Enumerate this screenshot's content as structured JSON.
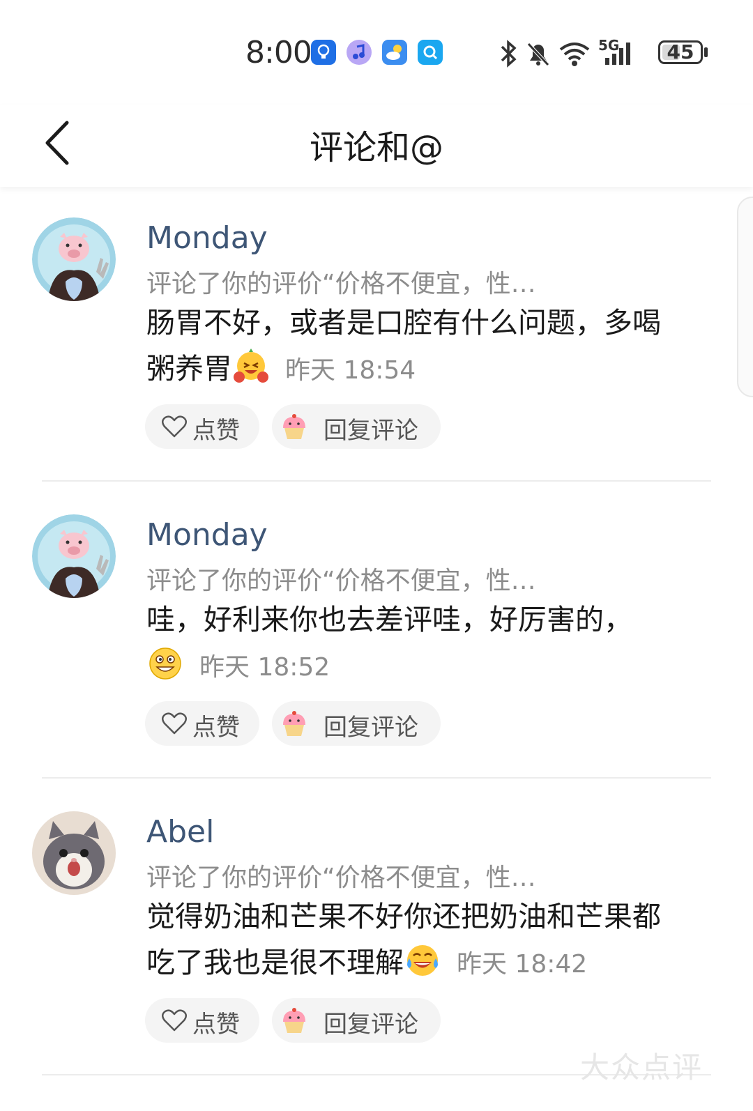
{
  "status_bar": {
    "time": "8:00",
    "app_icons": [
      "lightbulb-icon",
      "music-icon",
      "weather-icon",
      "search-app-icon"
    ],
    "indicators": [
      "bluetooth-icon",
      "mute-bell-icon",
      "wifi-icon",
      "signal-5g-icon"
    ],
    "network_label": "5G",
    "battery_level": "45"
  },
  "header": {
    "title": "评论和@",
    "back_icon": "chevron-left-icon"
  },
  "comments": [
    {
      "user": "Monday",
      "context": "评论了你的评价“价格不便宜，性…",
      "text_line1": "肠胃不好，或者是口腔有什么问题，多喝",
      "text_line2": "粥养胃",
      "emoji": "laughing-emoji",
      "time": "昨天 18:54",
      "like_label": "点赞",
      "reply_label": "回复评论"
    },
    {
      "user": "Monday",
      "context": "评论了你的评价“价格不便宜，性…",
      "text_line1": "哇，好利来你也去差评哇，好厉害的，",
      "text_line2": "",
      "emoji": "grinning-emoji",
      "time": "昨天 18:52",
      "like_label": "点赞",
      "reply_label": "回复评论"
    },
    {
      "user": "Abel",
      "context": "评论了你的评价“价格不便宜，性…",
      "text_line1": "觉得奶油和芒果不好你还把奶油和芒果都",
      "text_line2": "吃了我也是很不理解",
      "emoji": "crying-laughing-emoji",
      "time": "昨天 18:42",
      "like_label": "点赞",
      "reply_label": "回复评论"
    }
  ],
  "watermark": "大众点评",
  "colors": {
    "username": "#3e5676",
    "secondary_text": "#8c8c8c",
    "pill_bg": "#f4f4f4"
  }
}
